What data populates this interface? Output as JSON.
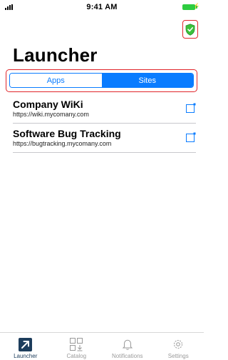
{
  "status_bar": {
    "time": "9:41 AM"
  },
  "header": {
    "title": "Launcher"
  },
  "segments": [
    {
      "label": "Apps",
      "active": false
    },
    {
      "label": "Sites",
      "active": true
    }
  ],
  "sites": [
    {
      "name": "Company WiKi",
      "url": "https://wiki.mycomany.com"
    },
    {
      "name": "Software Bug Tracking",
      "url": "https://bugtracking.mycomany.com"
    }
  ],
  "tabs": [
    {
      "label": "Launcher",
      "icon": "launcher-arrow-icon",
      "active": true
    },
    {
      "label": "Catalog",
      "icon": "catalog-grid-icon",
      "active": false
    },
    {
      "label": "Notifications",
      "icon": "bell-icon",
      "active": false
    },
    {
      "label": "Settings",
      "icon": "gear-icon",
      "active": false
    }
  ],
  "colors": {
    "accent": "#0a7cff",
    "highlight": "#e0262b",
    "shield": "#3cc13b",
    "tab_active": "#1d3d5c"
  }
}
